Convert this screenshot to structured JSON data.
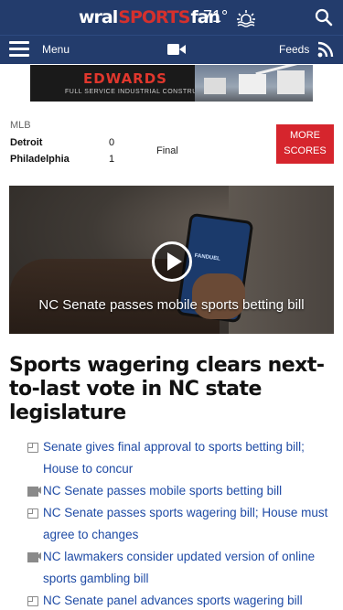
{
  "header": {
    "brand_wral": "wral",
    "brand_sports": "SPORTS",
    "brand_fan": "fan",
    "temperature": "71°",
    "weather_icon": "sunrise-weather-icon",
    "search_icon": "search-icon"
  },
  "nav": {
    "menu_label": "Menu",
    "video_icon": "video-camera-icon",
    "feeds_label": "Feeds",
    "rss_icon": "rss-icon"
  },
  "ad": {
    "logo": "EDWARDS",
    "tagline": "FULL SERVICE INDUSTRIAL CONSTRUCTION"
  },
  "scores": {
    "league": "MLB",
    "teams": [
      {
        "name": "Detroit",
        "score": "0"
      },
      {
        "name": "Philadelphia",
        "score": "1"
      }
    ],
    "status": "Final",
    "more_button": "MORE SCORES"
  },
  "video": {
    "caption": "NC Senate passes mobile sports betting bill",
    "phone_text": "FANDUEL"
  },
  "article": {
    "headline": "Sports wagering clears next-to-last vote in NC state legislature"
  },
  "related": [
    {
      "type": "doc",
      "text": "Senate gives final approval to sports betting bill; House to concur"
    },
    {
      "type": "video",
      "text": "NC Senate passes mobile sports betting bill"
    },
    {
      "type": "doc",
      "text": "NC Senate passes sports wagering bill; House must agree to changes"
    },
    {
      "type": "video",
      "text": "NC lawmakers consider updated version of online sports gambling bill"
    },
    {
      "type": "doc",
      "text": "NC Senate panel advances sports wagering bill"
    }
  ],
  "colors": {
    "header_bg": "#233c6c",
    "brand_red": "#d5302d",
    "button_red": "#d6252d",
    "link_blue": "#1f4ba5"
  }
}
